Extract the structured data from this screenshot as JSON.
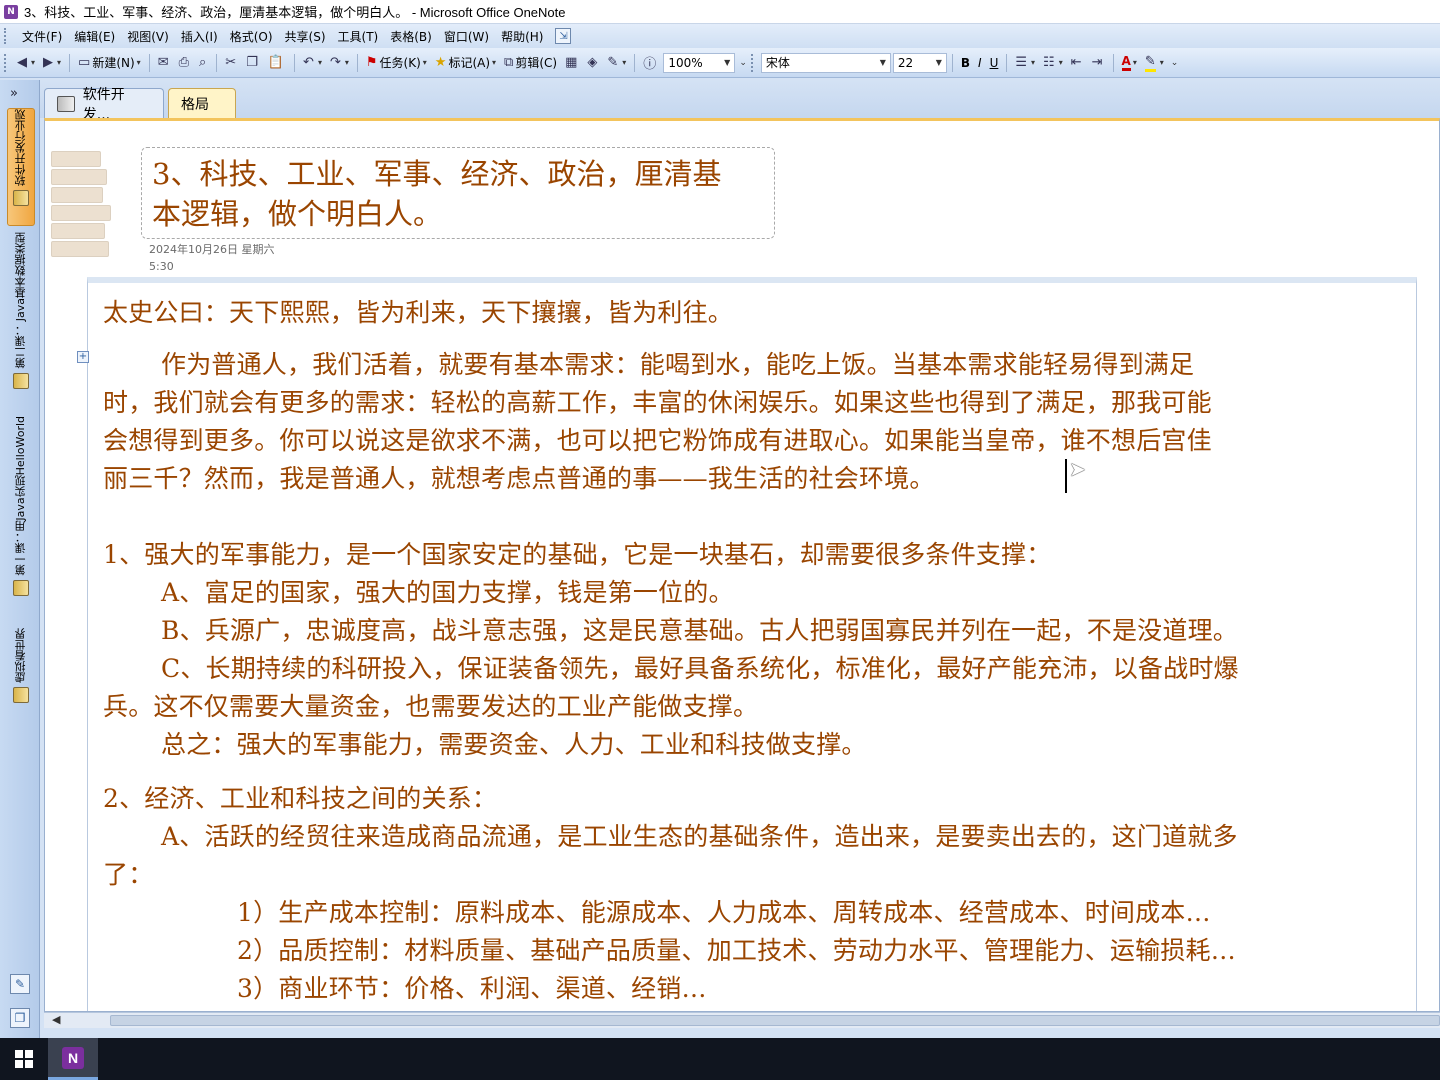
{
  "window": {
    "title": "3、科技、工业、军事、经济、政治，厘清基本逻辑，做个明白人。 - Microsoft Office OneNote",
    "app_icon": "N"
  },
  "menu": [
    "文件(F)",
    "编辑(E)",
    "视图(V)",
    "插入(I)",
    "格式(O)",
    "共享(S)",
    "工具(T)",
    "表格(B)",
    "窗口(W)",
    "帮助(H)"
  ],
  "toolbar": {
    "new_label": "新建(N)",
    "task_label": "任务(K)",
    "tag_label": "标记(A)",
    "clip_label": "剪辑(C)",
    "zoom": "100%",
    "font_name": "宋体",
    "font_size": "22",
    "bold": "B",
    "italic": "I",
    "underline": "U",
    "font_color": "A"
  },
  "navigator": {
    "expand": "»",
    "notebooks": [
      "软件开发行业观",
      "Java基本数据类型",
      "第一课：用Java实现HelloWorld",
      "虚拟看世界"
    ],
    "notebook_prefix_2": "第二课：",
    "notebook_prefix_3": "第一课："
  },
  "section_tabs": [
    "软件开发...",
    "格局"
  ],
  "page": {
    "title": "3、科技、工业、军事、经济、政治，厘清基本逻辑，做个明白人。",
    "title_line1": "3、科技、工业、军事、经济、政治，厘清基",
    "title_line2": "本逻辑，做个明白人。",
    "date": "2024年10月26日 星期六",
    "time": "5:30"
  },
  "content": {
    "line01": "太史公曰：天下熙熙，皆为利来，天下攘攘，皆为利往。",
    "line02": "作为普通人，我们活着，就要有基本需求：能喝到水，能吃上饭。当基本需求能轻易得到满足",
    "line03": "时，我们就会有更多的需求：轻松的高薪工作，丰富的休闲娱乐。如果这些也得到了满足，那我可能",
    "line04": "会想得到更多。你可以说这是欲求不满，也可以把它粉饰成有进取心。如果能当皇帝，谁不想后宫佳",
    "line05": "丽三千？然而，我是普通人，就想考虑点普通的事——我生活的社会环境。",
    "line06": "1、强大的军事能力，是一个国家安定的基础，它是一块基石，却需要很多条件支撑：",
    "line07": "A、富足的国家，强大的国力支撑，钱是第一位的。",
    "line08": "B、兵源广，忠诚度高，战斗意志强，这是民意基础。古人把弱国寡民并列在一起，不是没道理。",
    "line09": "C、长期持续的科研投入，保证装备领先，最好具备系统化，标准化，最好产能充沛，以备战时爆",
    "line10": "兵。这不仅需要大量资金，也需要发达的工业产能做支撑。",
    "line11": "总之：强大的军事能力，需要资金、人力、工业和科技做支撑。",
    "line12": "2、经济、工业和科技之间的关系：",
    "line13": "A、活跃的经贸往来造成商品流通，是工业生态的基础条件，造出来，是要卖出去的，这门道就多",
    "line14": "了：",
    "line15": "1）生产成本控制：原料成本、能源成本、人力成本、周转成本、经营成本、时间成本…",
    "line16": "2）品质控制：材料质量、基础产品质量、加工技术、劳动力水平、管理能力、运输损耗…",
    "line17": "3）商业环节：价格、利润、渠道、经销…"
  },
  "colors": {
    "text": "#9a4500",
    "accent": "#f3c45d",
    "chrome": "#d4e2f4"
  }
}
